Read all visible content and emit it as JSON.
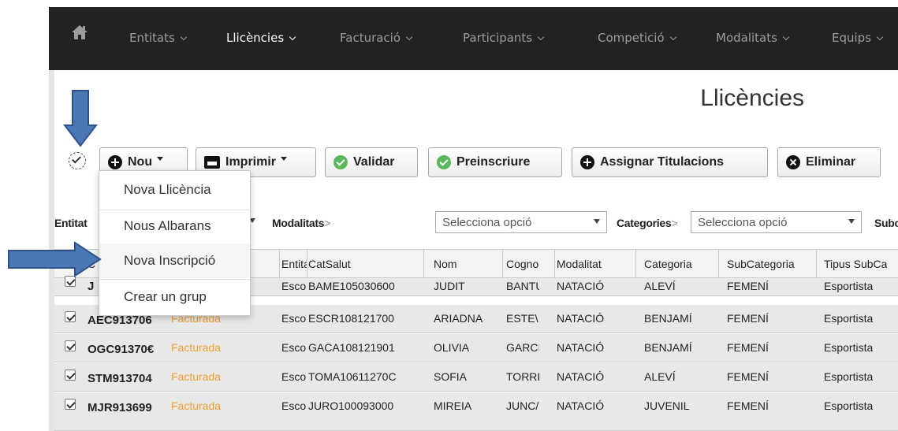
{
  "nav": {
    "items": [
      {
        "label": "Entitats",
        "active": false
      },
      {
        "label": "Llicències",
        "active": true
      },
      {
        "label": "Facturació",
        "active": false
      },
      {
        "label": "Participants",
        "active": false
      },
      {
        "label": "Competició",
        "active": false
      },
      {
        "label": "Modalitats",
        "active": false
      },
      {
        "label": "Equips",
        "active": false
      }
    ]
  },
  "page": {
    "title": "Llicències"
  },
  "toolbar": {
    "new_label": "Nou",
    "print_label": "Imprimir",
    "validate_label": "Validar",
    "preregister_label": "Preinscriure",
    "assign_label": "Assignar Titulacions",
    "delete_label": "Eliminar"
  },
  "dropdown": {
    "items": [
      {
        "label": "Nova Llicència"
      },
      {
        "label": "Nous Albarans"
      },
      {
        "label": "Nova Inscripció"
      },
      {
        "label": "Crear un grup"
      }
    ]
  },
  "filters": {
    "entitat_label": "Entitat",
    "modalitats_label": "Modalitats",
    "modalitats_placeholder": "Selecciona opció",
    "categories_label": "Categories",
    "categories_placeholder": "Selecciona opció",
    "subcategories_label": "Subcatego",
    "gt": ">"
  },
  "table": {
    "headers": [
      "C",
      "Entita",
      "CatSalut",
      "Nom",
      "Cognoi",
      "Modalitat",
      "Categoria",
      "SubCategoria",
      "Tipus SubCa"
    ],
    "rows": [
      {
        "code": "J",
        "status": "",
        "entitat": "Escol",
        "catsalut": "BAME105030600",
        "nom": "JUDIT",
        "cognom": "BANTU",
        "modalitat": "NATACIÓ",
        "categoria": "ALEVÍ",
        "subcategoria": "FEMENÍ",
        "tipus": "Esportista"
      },
      {
        "code": "AEC913706",
        "status": "Facturada",
        "entitat": "Escol",
        "catsalut": "ESCR108121700",
        "nom": "ARIADNA",
        "cognom": "ESTE\\",
        "modalitat": "NATACIÓ",
        "categoria": "BENJAMÍ",
        "subcategoria": "FEMENÍ",
        "tipus": "Esportista"
      },
      {
        "code": "OGC91370€",
        "status": "Facturada",
        "entitat": "Escol",
        "catsalut": "GACA108121901",
        "nom": "OLIVIA",
        "cognom": "GARCI",
        "modalitat": "NATACIÓ",
        "categoria": "BENJAMÍ",
        "subcategoria": "FEMENÍ",
        "tipus": "Esportista"
      },
      {
        "code": "STM913704",
        "status": "Facturada",
        "entitat": "Escol",
        "catsalut": "TOMA10611270C",
        "nom": "SOFIA",
        "cognom": "TORRI",
        "modalitat": "NATACIÓ",
        "categoria": "ALEVÍ",
        "subcategoria": "FEMENÍ",
        "tipus": "Esportista"
      },
      {
        "code": "MJR913699",
        "status": "Facturada",
        "entitat": "Escol",
        "catsalut": "JURO100093000",
        "nom": "MIREIA",
        "cognom": "JUNC/",
        "modalitat": "NATACIÓ",
        "categoria": "JUVENIL",
        "subcategoria": "FEMENÍ",
        "tipus": "Esportista"
      }
    ]
  },
  "colors": {
    "nav_bg": "#222222",
    "nav_text": "#9d9d9d",
    "nav_active": "#ffffff",
    "status": "#f0a030",
    "check_green": "#5cb85c",
    "arrow_fill": "#4a78b5",
    "arrow_stroke": "#2f528f"
  },
  "icons": {
    "home": "home-icon",
    "new": "plus-circle-icon",
    "print": "printer-icon",
    "validate": "check-circle-icon",
    "preregister": "check-circle-icon",
    "assign": "plus-circle-icon",
    "delete": "x-circle-icon"
  }
}
